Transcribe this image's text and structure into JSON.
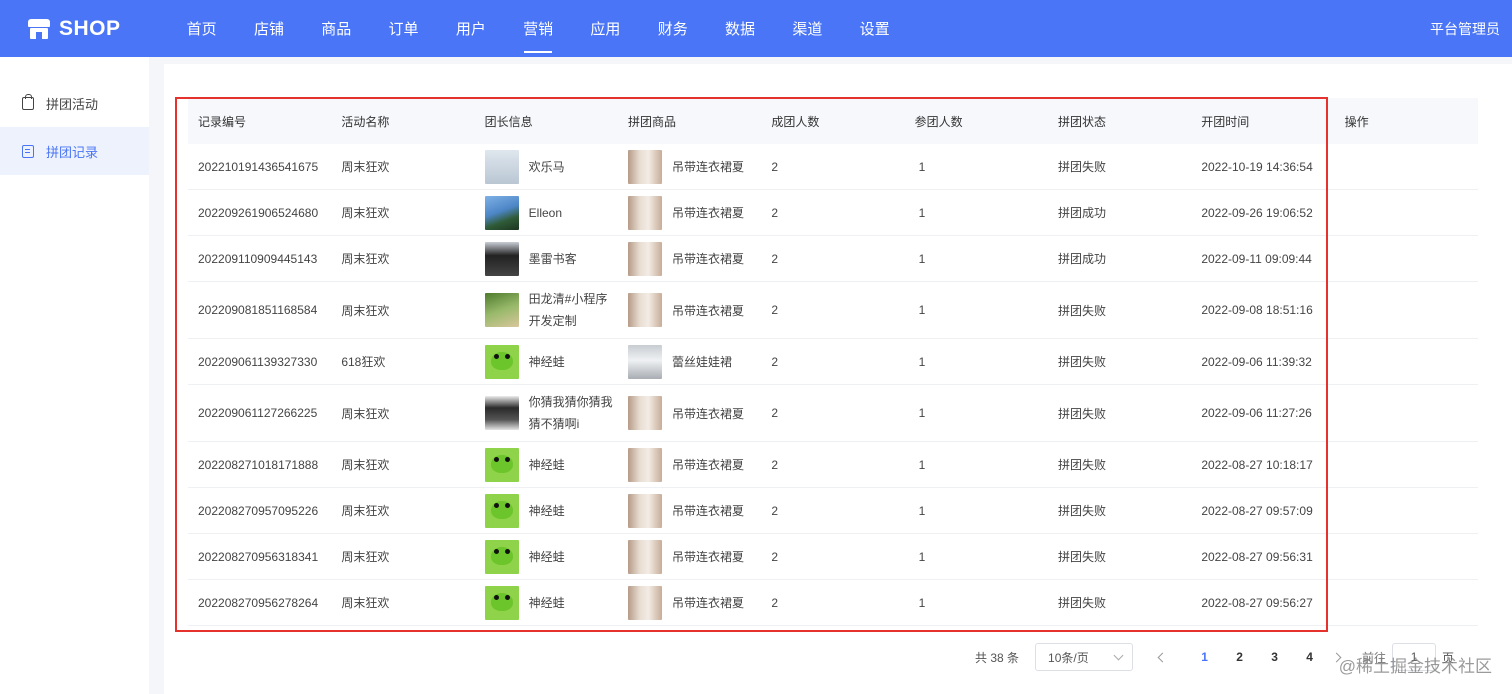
{
  "app": {
    "logo_text": "SHOP",
    "admin_label": "平台管理员"
  },
  "nav": {
    "items": [
      "首页",
      "店铺",
      "商品",
      "订单",
      "用户",
      "营销",
      "应用",
      "财务",
      "数据",
      "渠道",
      "设置"
    ],
    "active_index": 5
  },
  "sidebar": {
    "items": [
      {
        "label": "拼团活动",
        "icon": "bag-icon",
        "active": false
      },
      {
        "label": "拼团记录",
        "icon": "document-icon",
        "active": true
      }
    ]
  },
  "table": {
    "headers": [
      "记录编号",
      "活动名称",
      "团长信息",
      "拼团商品",
      "成团人数",
      "参团人数",
      "拼团状态",
      "开团时间",
      "操作"
    ],
    "rows": [
      {
        "id": "202210191436541675",
        "activity": "周末狂欢",
        "leader": "欢乐马",
        "leader_avatar": "mist",
        "product": "吊带连衣裙夏",
        "product_img": "dress",
        "group_size": "2",
        "joined": "1",
        "status": "拼团失败",
        "time": "2022-10-19 14:36:54"
      },
      {
        "id": "202209261906524680",
        "activity": "周末狂欢",
        "leader": "Elleon",
        "leader_avatar": "palm",
        "product": "吊带连衣裙夏",
        "product_img": "dress",
        "group_size": "2",
        "joined": "1",
        "status": "拼团成功",
        "time": "2022-09-26 19:06:52"
      },
      {
        "id": "202209110909445143",
        "activity": "周末狂欢",
        "leader": "墨雷书客",
        "leader_avatar": "person",
        "product": "吊带连衣裙夏",
        "product_img": "dress",
        "group_size": "2",
        "joined": "1",
        "status": "拼团成功",
        "time": "2022-09-11 09:09:44"
      },
      {
        "id": "202209081851168584",
        "activity": "周末狂欢",
        "leader": "田龙清#小程序开发定制",
        "leader_avatar": "green",
        "product": "吊带连衣裙夏",
        "product_img": "dress",
        "group_size": "2",
        "joined": "1",
        "status": "拼团失败",
        "time": "2022-09-08 18:51:16"
      },
      {
        "id": "202209061139327330",
        "activity": "618狂欢",
        "leader": "神经蛙",
        "leader_avatar": "frog",
        "product": "蕾丝娃娃裙",
        "product_img": "dress2",
        "group_size": "2",
        "joined": "1",
        "status": "拼团失败",
        "time": "2022-09-06 11:39:32"
      },
      {
        "id": "202209061127266225",
        "activity": "周末狂欢",
        "leader": "你猜我猜你猜我猜不猜啊i",
        "leader_avatar": "girl",
        "product": "吊带连衣裙夏",
        "product_img": "dress",
        "group_size": "2",
        "joined": "1",
        "status": "拼团失败",
        "time": "2022-09-06 11:27:26"
      },
      {
        "id": "202208271018171888",
        "activity": "周末狂欢",
        "leader": "神经蛙",
        "leader_avatar": "frog",
        "product": "吊带连衣裙夏",
        "product_img": "dress",
        "group_size": "2",
        "joined": "1",
        "status": "拼团失败",
        "time": "2022-08-27 10:18:17"
      },
      {
        "id": "202208270957095226",
        "activity": "周末狂欢",
        "leader": "神经蛙",
        "leader_avatar": "frog",
        "product": "吊带连衣裙夏",
        "product_img": "dress",
        "group_size": "2",
        "joined": "1",
        "status": "拼团失败",
        "time": "2022-08-27 09:57:09"
      },
      {
        "id": "202208270956318341",
        "activity": "周末狂欢",
        "leader": "神经蛙",
        "leader_avatar": "frog",
        "product": "吊带连衣裙夏",
        "product_img": "dress",
        "group_size": "2",
        "joined": "1",
        "status": "拼团失败",
        "time": "2022-08-27 09:56:31"
      },
      {
        "id": "202208270956278264",
        "activity": "周末狂欢",
        "leader": "神经蛙",
        "leader_avatar": "frog",
        "product": "吊带连衣裙夏",
        "product_img": "dress",
        "group_size": "2",
        "joined": "1",
        "status": "拼团失败",
        "time": "2022-08-27 09:56:27"
      }
    ]
  },
  "pagination": {
    "total_label": "共 38 条",
    "page_size": "10条/页",
    "pages": [
      "1",
      "2",
      "3",
      "4"
    ],
    "current": "1",
    "goto_label": "前往",
    "goto_value": "1",
    "page_unit": "页"
  },
  "watermark": "@稀土掘金技术社区",
  "colors": {
    "primary": "#4a75f6",
    "highlight_border": "#e5322d"
  }
}
